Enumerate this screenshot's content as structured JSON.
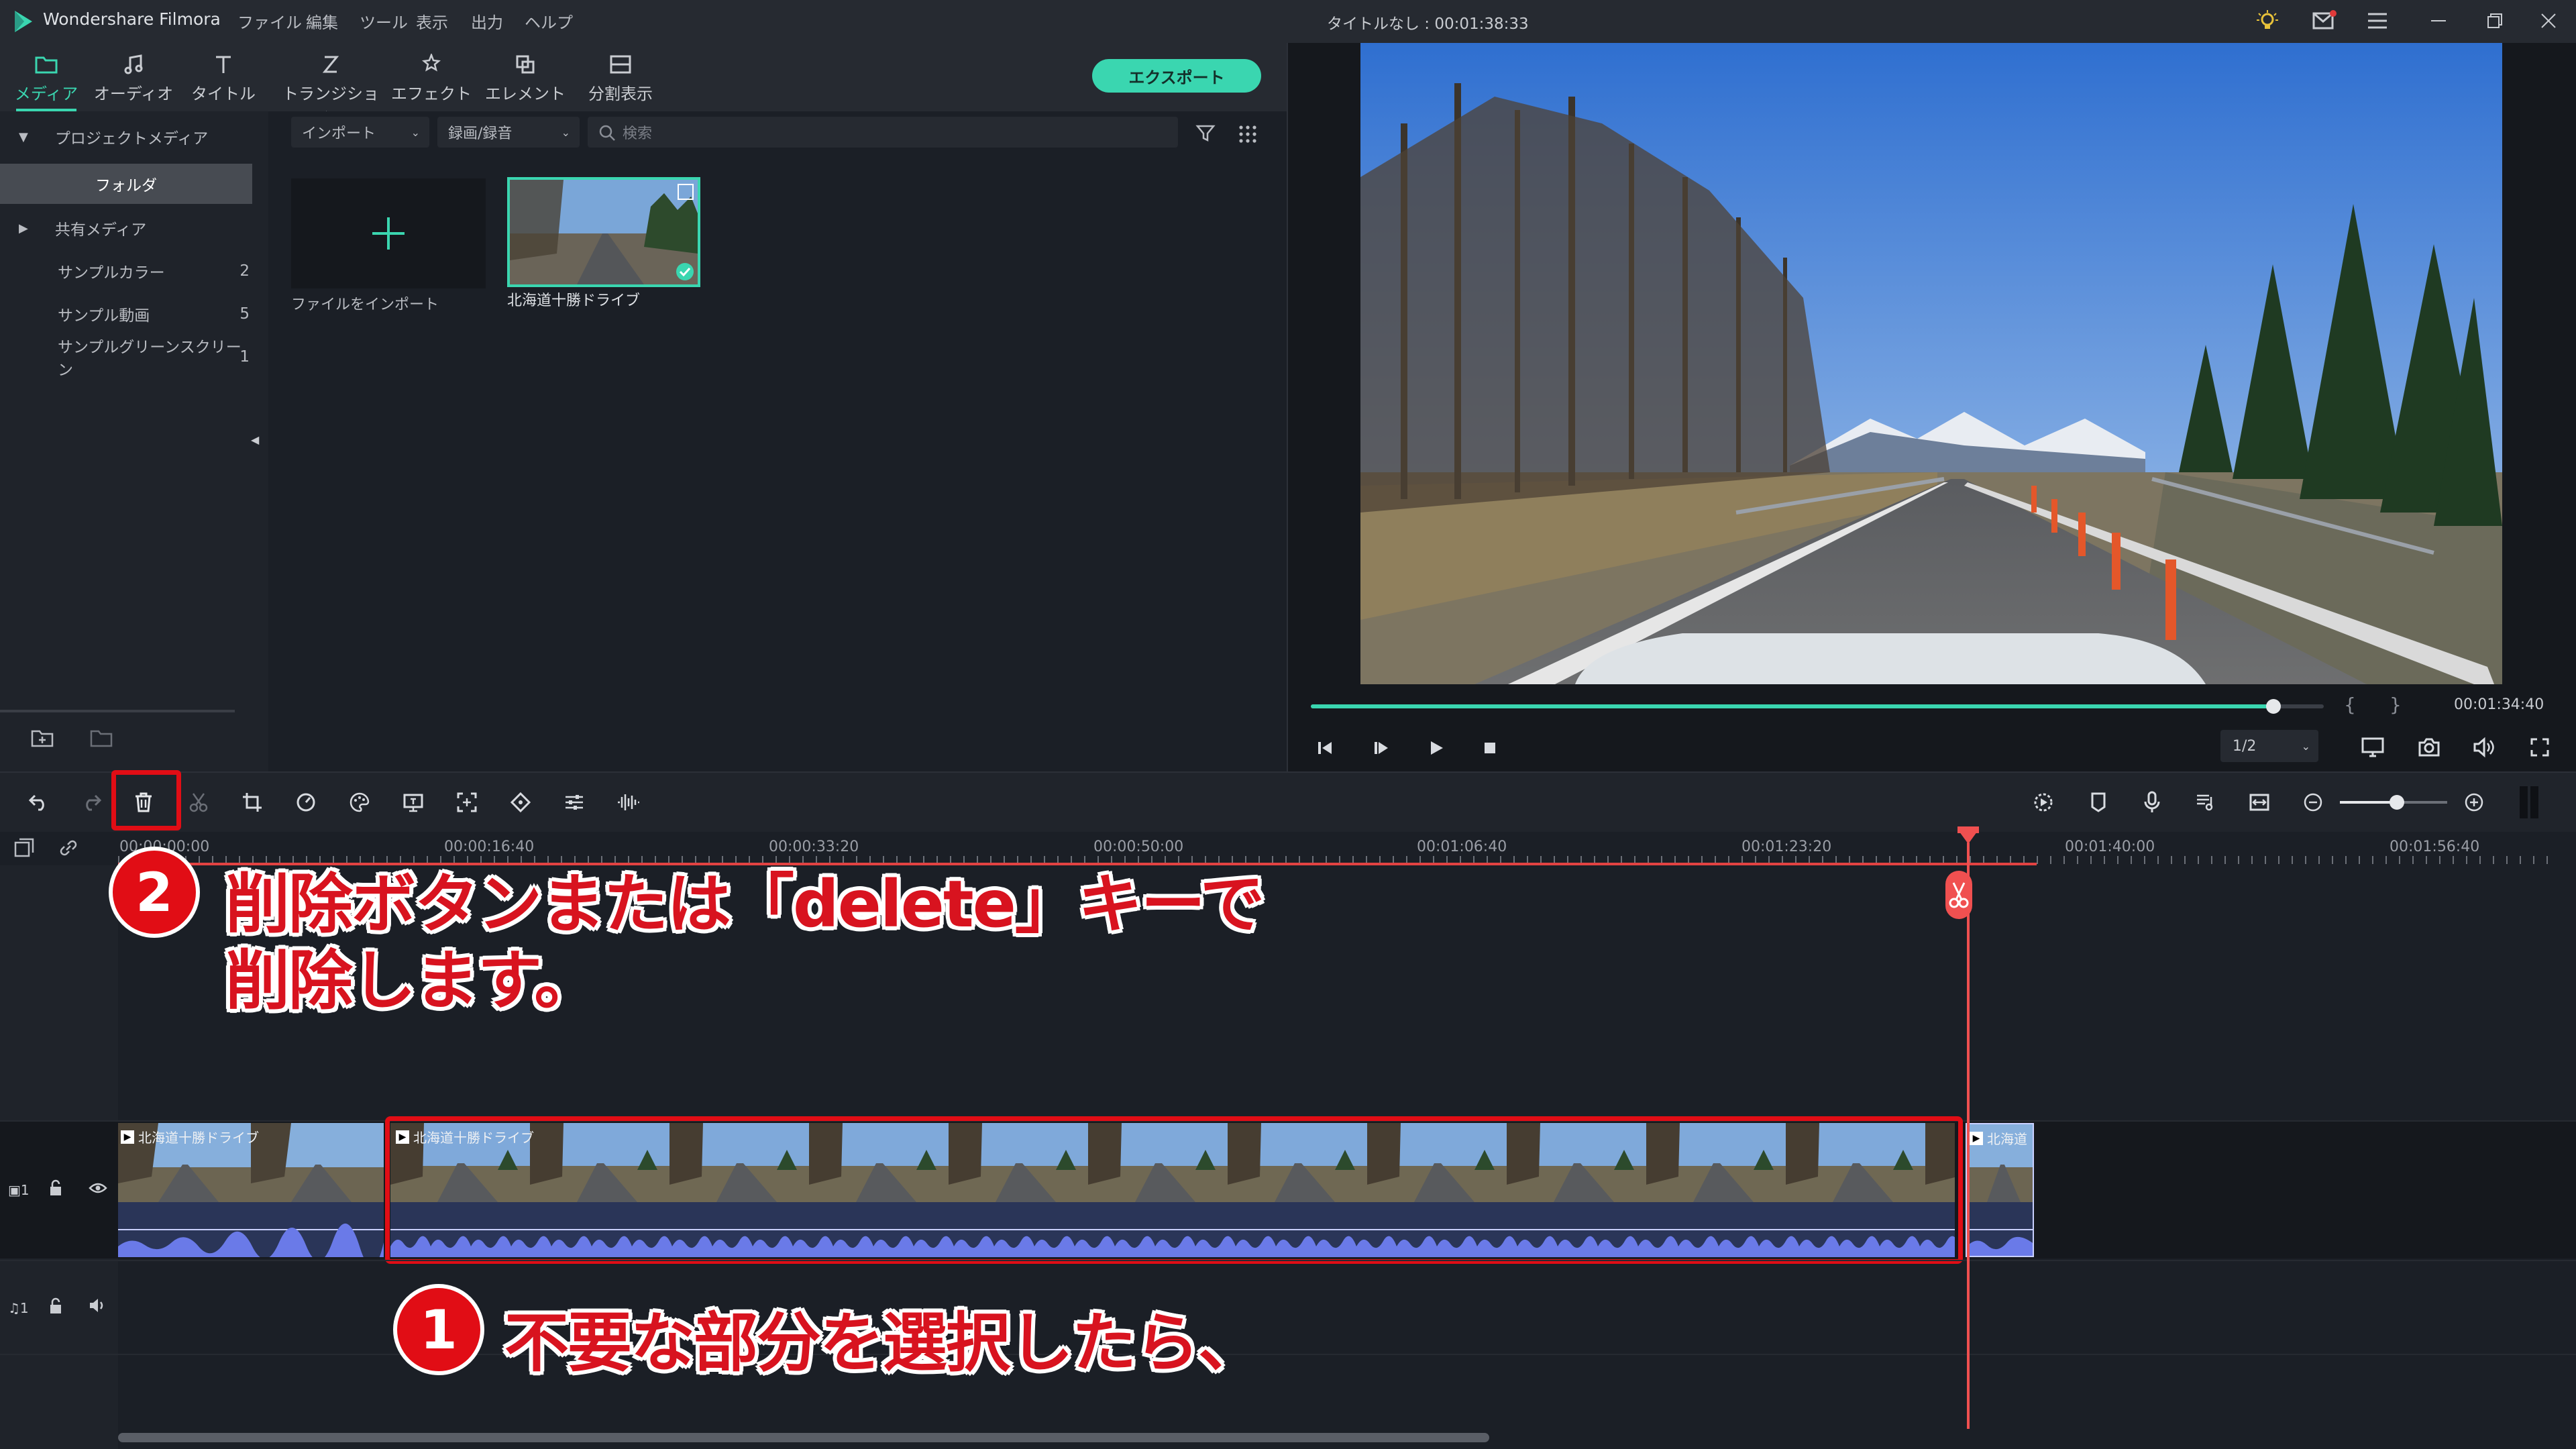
{
  "app": {
    "name": "Wondershare Filmora",
    "project_title": "タイトルなし : 00:01:38:33"
  },
  "menu": [
    "ファイル",
    "編集",
    "ツール",
    "表示",
    "出力",
    "ヘルプ"
  ],
  "media_tabs": [
    {
      "label": "メディア",
      "icon": "folder-icon",
      "active": true
    },
    {
      "label": "オーディオ",
      "icon": "music-note-icon",
      "active": false
    },
    {
      "label": "タイトル",
      "icon": "title-t-icon",
      "active": false
    },
    {
      "label": "トランジション",
      "icon": "transition-icon",
      "active": false
    },
    {
      "label": "エフェクト",
      "icon": "effects-icon",
      "active": false
    },
    {
      "label": "エレメント",
      "icon": "elements-icon",
      "active": false
    },
    {
      "label": "分割表示",
      "icon": "split-screen-icon",
      "active": false
    }
  ],
  "export_label": "エクスポート",
  "library": {
    "project_media": "プロジェクトメディア",
    "folder": "フォルダ",
    "shared_media": "共有メディア",
    "items": [
      {
        "label": "サンプルカラー",
        "count": "2"
      },
      {
        "label": "サンプル動画",
        "count": "5"
      },
      {
        "label": "サンプルグリーンスクリーン",
        "count": "1"
      }
    ]
  },
  "media_bar": {
    "import_label": "インポート",
    "record_label": "録画/録音",
    "search_placeholder": "検索"
  },
  "media_items": {
    "import_tile_label": "ファイルをインポート",
    "clip_label": "北海道十勝ドライブ"
  },
  "preview": {
    "progress": 0.95,
    "timecode": "00:01:34:40",
    "quality": "1/2"
  },
  "ruler_labels": [
    "00:00:00:00",
    "00:00:16:40",
    "00:00:33:20",
    "00:00:50:00",
    "00:01:06:40",
    "00:01:23:20",
    "00:01:40:00",
    "00:01:56:40"
  ],
  "clips": {
    "label": "北海道十勝ドライブ",
    "label_short": "北海道"
  },
  "annotations": {
    "step2_number": "2",
    "step2_line1": "削除ボタンまたは「delete」キーで",
    "step2_line2": "削除します。",
    "step1_number": "1",
    "step1_text": "不要な部分を選択したら、"
  },
  "colors": {
    "accent": "#3ad6b0",
    "annotation_red": "#e10d15",
    "playhead": "#f05050"
  }
}
